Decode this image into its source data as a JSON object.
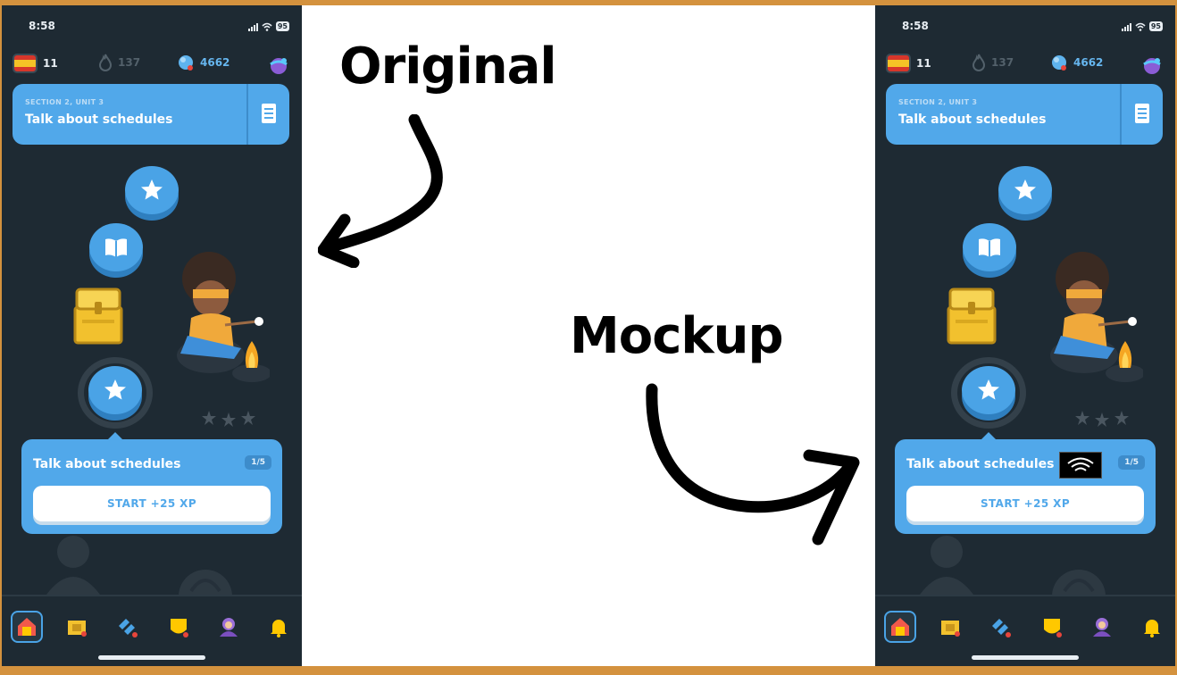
{
  "labels": {
    "left": "Original",
    "right": "Mockup"
  },
  "phone": {
    "time": "8:58",
    "battery": "95",
    "stats": {
      "flag_count": "11",
      "streak": "137",
      "gems": "4662"
    },
    "unit": {
      "section": "SECTION 2, UNIT 3",
      "title": "Talk about schedules"
    },
    "popup": {
      "title": "Talk about schedules",
      "progress": "1/5",
      "button": "START +25 XP"
    },
    "nav": [
      "home-icon",
      "leaderboard-icon",
      "quests-icon",
      "shield-icon",
      "profile-icon",
      "bell-icon"
    ]
  },
  "colors": {
    "background": "#1e2a33",
    "accent": "#51a8ea",
    "frame": "#d4923e"
  }
}
